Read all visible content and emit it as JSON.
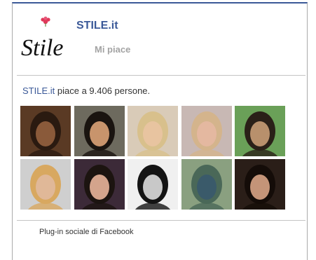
{
  "page": {
    "name": "STILE.it",
    "logo_text": "Stile",
    "like_label": "Mi piace"
  },
  "summary": {
    "page_link": "STILE.it",
    "likes_text": "piace a 9.406 persone."
  },
  "faces": [
    {
      "bg": "#5a3a24",
      "skin": "#8a5a3a",
      "hair": "#2a1a10"
    },
    {
      "bg": "#6d6a5e",
      "skin": "#c8946c",
      "hair": "#1a1410"
    },
    {
      "bg": "#d9cbb8",
      "skin": "#e8c4a0",
      "hair": "#d8c08c"
    },
    {
      "bg": "#c8b8b4",
      "skin": "#e4b8a0",
      "hair": "#d4b48c"
    },
    {
      "bg": "#6aa058",
      "skin": "#b8906c",
      "hair": "#2a2018"
    },
    {
      "bg": "#cfcfcf",
      "skin": "#e0b898",
      "hair": "#d8a860"
    },
    {
      "bg": "#3c2a38",
      "skin": "#d4a48c",
      "hair": "#1c1410"
    },
    {
      "bg": "#f0f0f0",
      "skin": "#c8c8c8",
      "hair": "#141414"
    },
    {
      "bg": "#8aa080",
      "skin": "#3a5a6a",
      "hair": "#4a6858"
    },
    {
      "bg": "#2a1e18",
      "skin": "#c49478",
      "hair": "#140c08"
    }
  ],
  "footer": {
    "label": "Plug-in sociale di Facebook"
  },
  "colors": {
    "brand": "#3b5998",
    "muted": "#a3a3a3",
    "logo_flower": "#e0385a"
  }
}
